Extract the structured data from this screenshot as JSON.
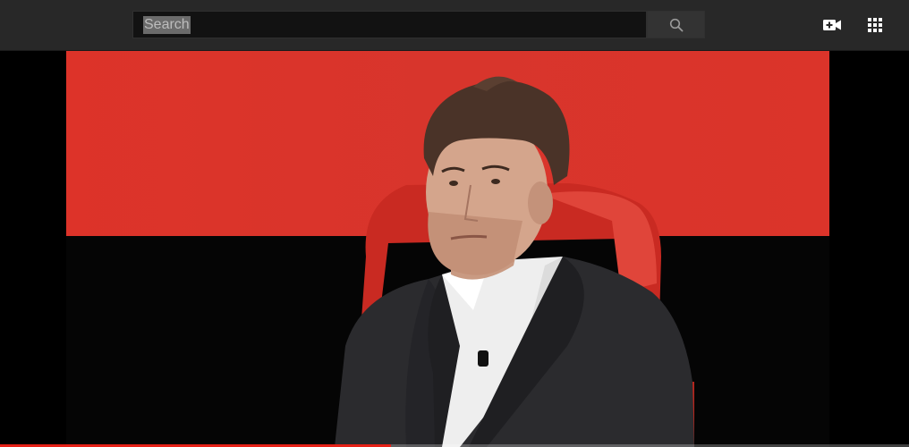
{
  "search": {
    "placeholder": "Search",
    "highlight_text": "Search"
  },
  "icons": {
    "search": "search-icon",
    "upload": "video-upload-icon",
    "apps": "apps-grid-icon"
  },
  "player": {
    "progress_fraction": 0.43
  },
  "colors": {
    "topbar": "#282828",
    "backdrop_red": "#dd3329",
    "progress_red": "#e62117"
  }
}
